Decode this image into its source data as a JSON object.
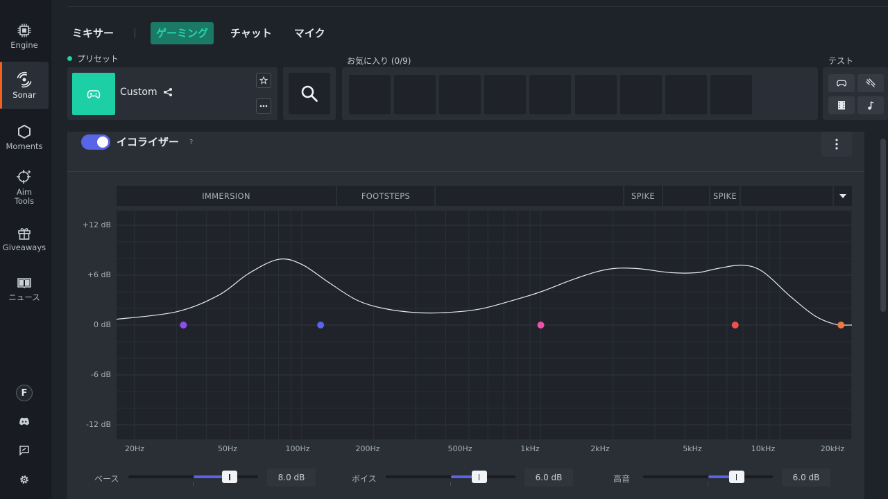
{
  "sidebar": {
    "items": [
      {
        "label": "Engine",
        "icon": "chip-icon"
      },
      {
        "label": "Sonar",
        "icon": "sonar-icon",
        "active": true
      },
      {
        "label": "Moments",
        "icon": "hexagon-icon"
      },
      {
        "label": "Aim\nTools",
        "icon": "crosshair-icon"
      },
      {
        "label": "Giveaways",
        "icon": "gift-icon"
      },
      {
        "label": "ニュース",
        "icon": "book-icon"
      }
    ],
    "avatar_letter": "F",
    "bottom_icons": [
      "discord-icon",
      "feedback-icon",
      "settings-icon"
    ]
  },
  "tabs": [
    {
      "label": "ミキサー"
    },
    {
      "label": "ゲーミング",
      "active": true
    },
    {
      "label": "チャット"
    },
    {
      "label": "マイク"
    }
  ],
  "preset": {
    "label": "プリセット",
    "name": "Custom",
    "icon": "gamepad-icon"
  },
  "favorites": {
    "label": "お気に入り (0/9)",
    "slots": 9
  },
  "test": {
    "label": "テスト",
    "buttons": [
      "gamepad-icon",
      "shots-icon",
      "film-icon",
      "music-icon"
    ]
  },
  "equalizer": {
    "title": "イコライザー",
    "help": "?",
    "enabled": true,
    "bands": [
      "IMMERSION",
      "FOOTSTEPS",
      "",
      "SPIKE",
      "",
      "SPIKE",
      ""
    ],
    "y_labels": [
      "+12 dB",
      "+6 dB",
      "0 dB",
      "-6 dB",
      "-12 dB"
    ],
    "x_labels": [
      "20Hz",
      "50Hz",
      "100Hz",
      "200Hz",
      "500Hz",
      "1kHz",
      "2kHz",
      "5kHz",
      "10kHz",
      "20kHz"
    ],
    "points": [
      {
        "freq": 32,
        "gain": 0,
        "color": "#8b4ff0"
      },
      {
        "freq": 120,
        "gain": 0,
        "color": "#5765e6"
      },
      {
        "freq": 1000,
        "gain": 0,
        "color": "#f050a8"
      },
      {
        "freq": 6500,
        "gain": 0,
        "color": "#f05050"
      },
      {
        "freq": 18000,
        "gain": 0,
        "color": "#f07840"
      }
    ],
    "curve": [
      [
        20,
        0.7
      ],
      [
        30,
        1.6
      ],
      [
        45,
        3.6
      ],
      [
        60,
        6.2
      ],
      [
        80,
        7.9
      ],
      [
        100,
        7.3
      ],
      [
        130,
        5.1
      ],
      [
        170,
        3.0
      ],
      [
        220,
        2.0
      ],
      [
        300,
        1.5
      ],
      [
        400,
        1.5
      ],
      [
        550,
        1.9
      ],
      [
        750,
        2.9
      ],
      [
        1000,
        4.0
      ],
      [
        1400,
        5.6
      ],
      [
        1900,
        6.7
      ],
      [
        2500,
        6.8
      ],
      [
        3500,
        6.3
      ],
      [
        4500,
        6.3
      ],
      [
        5500,
        6.8
      ],
      [
        7000,
        7.2
      ],
      [
        8500,
        6.4
      ],
      [
        11000,
        3.5
      ],
      [
        14000,
        1.1
      ],
      [
        17000,
        0.1
      ],
      [
        20000,
        0.0
      ]
    ]
  },
  "sliders": [
    {
      "label": "ベース",
      "value": "8.0 dB",
      "fraction": 0.78
    },
    {
      "label": "ボイス",
      "value": "6.0 dB",
      "fraction": 0.72
    },
    {
      "label": "高音",
      "value": "6.0 dB",
      "fraction": 0.72
    }
  ]
}
